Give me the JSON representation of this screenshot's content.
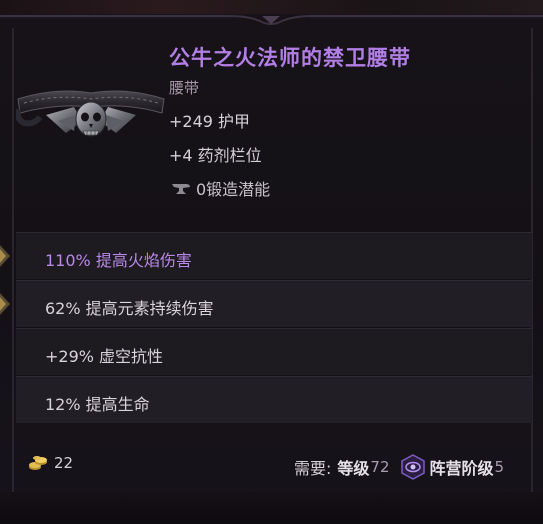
{
  "item": {
    "name": "公牛之火法师的禁卫腰带",
    "type": "腰带",
    "implicits": [
      "+249 护甲",
      "+4 药剂栏位"
    ],
    "forging_potential": "0锻造潜能"
  },
  "affixes": [
    "110% 提高火焰伤害",
    "62% 提高元素持续伤害",
    "+29% 虚空抗性",
    "12% 提高生命"
  ],
  "footer": {
    "gold": "22",
    "requirement_label": "需要:",
    "level_label": "等级",
    "level_value": "72",
    "faction_label": "阵营阶级",
    "faction_value": "5"
  },
  "colors": {
    "item_name": "#b27fe6",
    "fire_affix": "#b88ae8",
    "text": "#d6d0d8"
  },
  "icons": [
    "belt-item-icon",
    "anvil-icon",
    "gold-coins-icon",
    "faction-eye-icon"
  ]
}
